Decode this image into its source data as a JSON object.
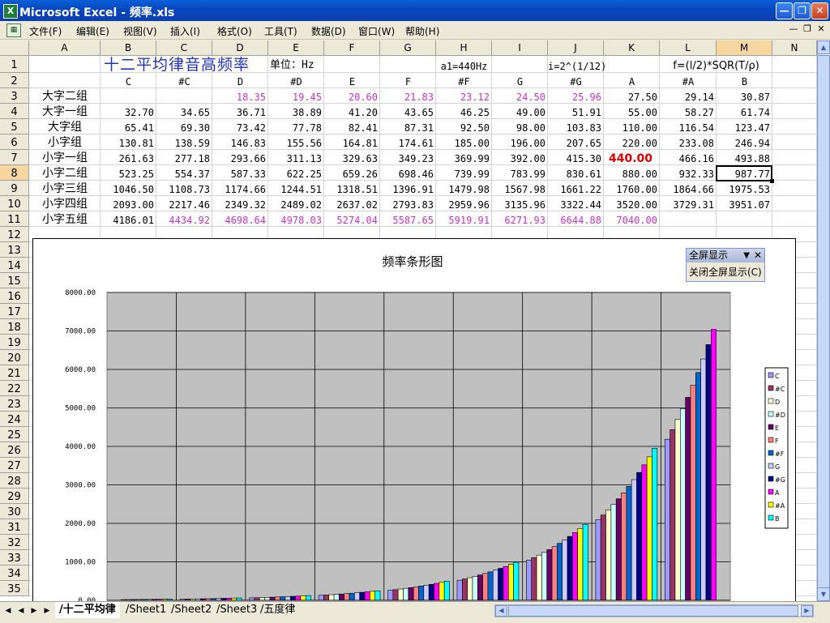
{
  "window": {
    "title": "Microsoft Excel - 频率.xls",
    "app_icon": "excel-icon"
  },
  "menu": [
    "文件(F)",
    "编辑(E)",
    "视图(V)",
    "插入(I)",
    "格式(O)",
    "工具(T)",
    "数据(D)",
    "窗口(W)",
    "帮助(H)"
  ],
  "columns": [
    "A",
    "B",
    "C",
    "D",
    "E",
    "F",
    "G",
    "H",
    "I",
    "J",
    "K",
    "L",
    "M",
    "N"
  ],
  "selected_column": "M",
  "selected_row": 8,
  "rows": [
    "1",
    "2",
    "3",
    "4",
    "5",
    "6",
    "7",
    "8",
    "9",
    "10",
    "11",
    "12",
    "13",
    "14",
    "15",
    "16",
    "17",
    "18",
    "19",
    "20",
    "21",
    "22",
    "23",
    "24",
    "25",
    "26",
    "27",
    "28",
    "29",
    "30",
    "31",
    "32",
    "33",
    "34",
    "35"
  ],
  "header_row1": {
    "title": "十二平均律音高频率",
    "unit": "单位：Hz",
    "a1": "a1=440Hz",
    "ratio": "i=2^(1/12)",
    "formula": "f=(l/2)*SQR(T/ρ)"
  },
  "note_names": [
    "C",
    "#C",
    "D",
    "#D",
    "E",
    "F",
    "#F",
    "G",
    "#G",
    "A",
    "#A",
    "B"
  ],
  "groups": [
    {
      "name": "大字二组",
      "values": [
        "",
        "",
        "18.35",
        "19.45",
        "20.60",
        "21.83",
        "23.12",
        "24.50",
        "25.96",
        "27.50",
        "29.14",
        "30.87"
      ],
      "pink": [
        2,
        3,
        4,
        5,
        6,
        7,
        8
      ]
    },
    {
      "name": "大字一组",
      "values": [
        "32.70",
        "34.65",
        "36.71",
        "38.89",
        "41.20",
        "43.65",
        "46.25",
        "49.00",
        "51.91",
        "55.00",
        "58.27",
        "61.74"
      ],
      "pink": []
    },
    {
      "name": "大字组",
      "values": [
        "65.41",
        "69.30",
        "73.42",
        "77.78",
        "82.41",
        "87.31",
        "92.50",
        "98.00",
        "103.83",
        "110.00",
        "116.54",
        "123.47"
      ],
      "pink": []
    },
    {
      "name": "小字组",
      "values": [
        "130.81",
        "138.59",
        "146.83",
        "155.56",
        "164.81",
        "174.61",
        "185.00",
        "196.00",
        "207.65",
        "220.00",
        "233.08",
        "246.94"
      ],
      "pink": []
    },
    {
      "name": "小字一组",
      "values": [
        "261.63",
        "277.18",
        "293.66",
        "311.13",
        "329.63",
        "349.23",
        "369.99",
        "392.00",
        "415.30",
        "440.00",
        "466.16",
        "493.88"
      ],
      "pink": []
    },
    {
      "name": "小字二组",
      "values": [
        "523.25",
        "554.37",
        "587.33",
        "622.25",
        "659.26",
        "698.46",
        "739.99",
        "783.99",
        "830.61",
        "880.00",
        "932.33",
        "987.77"
      ],
      "pink": []
    },
    {
      "name": "小字三组",
      "values": [
        "1046.50",
        "1108.73",
        "1174.66",
        "1244.51",
        "1318.51",
        "1396.91",
        "1479.98",
        "1567.98",
        "1661.22",
        "1760.00",
        "1864.66",
        "1975.53"
      ],
      "pink": []
    },
    {
      "name": "小字四组",
      "values": [
        "2093.00",
        "2217.46",
        "2349.32",
        "2489.02",
        "2637.02",
        "2793.83",
        "2959.96",
        "3135.96",
        "3322.44",
        "3520.00",
        "3729.31",
        "3951.07"
      ],
      "pink": []
    },
    {
      "name": "小字五组",
      "values": [
        "4186.01",
        "4434.92",
        "4698.64",
        "4978.03",
        "5274.04",
        "5587.65",
        "5919.91",
        "6271.93",
        "6644.88",
        "7040.00",
        "",
        ""
      ],
      "pink": [
        1,
        2,
        3,
        4,
        5,
        6,
        7,
        8,
        9
      ]
    }
  ],
  "highlight": {
    "group": 4,
    "note": 9,
    "color": "#dd0000"
  },
  "chart_data": {
    "type": "bar",
    "title": "频率条形图",
    "categories": [
      "大字二组",
      "大字一组",
      "大字组",
      "小字组",
      "小字一组",
      "小字二组",
      "小字三组",
      "小字四组",
      "小字五组"
    ],
    "ylim": [
      0,
      8000
    ],
    "yticks": [
      "0.00",
      "1000.00",
      "2000.00",
      "3000.00",
      "4000.00",
      "5000.00",
      "6000.00",
      "7000.00",
      "8000.00"
    ],
    "grid": true,
    "legend_position": "right",
    "plot_background": "#c0c0c0",
    "series": [
      {
        "name": "C",
        "color": "#9999ff",
        "values": [
          null,
          32.7,
          65.41,
          130.81,
          261.63,
          523.25,
          1046.5,
          2093.0,
          4186.01
        ]
      },
      {
        "name": "#C",
        "color": "#993366",
        "values": [
          null,
          34.65,
          69.3,
          138.59,
          277.18,
          554.37,
          1108.73,
          2217.46,
          4434.92
        ]
      },
      {
        "name": "D",
        "color": "#ffffcc",
        "values": [
          18.35,
          36.71,
          73.42,
          146.83,
          293.66,
          587.33,
          1174.66,
          2349.32,
          4698.64
        ]
      },
      {
        "name": "#D",
        "color": "#ccffff",
        "values": [
          19.45,
          38.89,
          77.78,
          155.56,
          311.13,
          622.25,
          1244.51,
          2489.02,
          4978.03
        ]
      },
      {
        "name": "E",
        "color": "#660066",
        "values": [
          20.6,
          41.2,
          82.41,
          164.81,
          329.63,
          659.26,
          1318.51,
          2637.02,
          5274.04
        ]
      },
      {
        "name": "F",
        "color": "#ff8080",
        "values": [
          21.83,
          43.65,
          87.31,
          174.61,
          349.23,
          698.46,
          1396.91,
          2793.83,
          5587.65
        ]
      },
      {
        "name": "#F",
        "color": "#0066cc",
        "values": [
          23.12,
          46.25,
          92.5,
          185.0,
          369.99,
          739.99,
          1479.98,
          2959.96,
          5919.91
        ]
      },
      {
        "name": "G",
        "color": "#ccccff",
        "values": [
          24.5,
          49.0,
          98.0,
          196.0,
          392.0,
          783.99,
          1567.98,
          3135.96,
          6271.93
        ]
      },
      {
        "name": "#G",
        "color": "#000080",
        "values": [
          25.96,
          51.91,
          103.83,
          207.65,
          415.3,
          830.61,
          1661.22,
          3322.44,
          6644.88
        ]
      },
      {
        "name": "A",
        "color": "#ff00ff",
        "values": [
          27.5,
          55.0,
          110.0,
          220.0,
          440.0,
          880.0,
          1760.0,
          3520.0,
          7040.0
        ]
      },
      {
        "name": "#A",
        "color": "#ffff00",
        "values": [
          29.14,
          58.27,
          116.54,
          233.08,
          466.16,
          932.33,
          1864.66,
          3729.31,
          null
        ]
      },
      {
        "name": "B",
        "color": "#00ffff",
        "values": [
          30.87,
          61.74,
          123.47,
          246.94,
          493.88,
          987.77,
          1975.53,
          3951.07,
          null
        ]
      }
    ]
  },
  "fullscreen_toolbar": {
    "title": "全屏显示",
    "button": "关闭全屏显示(C)"
  },
  "sheet_tabs": [
    "十二平均律",
    "Sheet1",
    "Sheet2",
    "Sheet3",
    "五度律"
  ],
  "active_tab": 0
}
